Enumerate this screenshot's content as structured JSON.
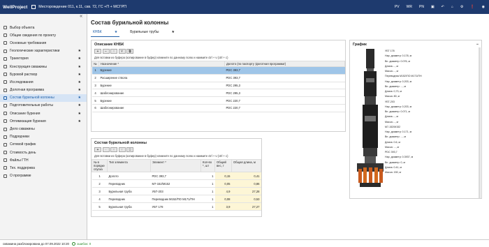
{
  "topbar": {
    "brand": "WellProject",
    "field": "Месторождение 011, к.11, скв. 72, ГС +П + МСГРП",
    "actions": [
      "PV",
      "WR",
      "PN"
    ]
  },
  "sidebar": {
    "collapse": "«",
    "items": [
      {
        "label": "Выбор объекта",
        "star": ""
      },
      {
        "label": "Общие сведения по проекту",
        "star": ""
      },
      {
        "label": "Основные требования",
        "star": ""
      },
      {
        "label": "Геологические характеристики",
        "star": "★"
      },
      {
        "label": "Траектория",
        "star": "★"
      },
      {
        "label": "Конструкция скважины",
        "star": "★"
      },
      {
        "label": "Буровой раствор",
        "star": "★"
      },
      {
        "label": "Исследования",
        "star": "★"
      },
      {
        "label": "Долотная программа",
        "star": "★"
      },
      {
        "label": "Состав бурильной колонны",
        "star": "★",
        "active": true
      },
      {
        "label": "Подготовительные работы",
        "star": "★"
      },
      {
        "label": "Описание бурения",
        "star": "★"
      },
      {
        "label": "Оптимизация бурения",
        "star": "★"
      },
      {
        "label": "Дело скважины",
        "star": ""
      },
      {
        "label": "Подрядчики",
        "star": ""
      },
      {
        "label": "Сетевой график",
        "star": ""
      },
      {
        "label": "Стоимость день",
        "star": ""
      },
      {
        "label": "Файлы ГТН",
        "star": ""
      },
      {
        "label": "Тех. поддержка",
        "star": ""
      },
      {
        "label": "О программе",
        "star": ""
      }
    ]
  },
  "main": {
    "title": "Состав бурильной колонны",
    "tabs": [
      {
        "label": "КНБК",
        "star": "★"
      },
      {
        "label": "Бурильные трубы",
        "star": "★"
      }
    ]
  },
  "knbk": {
    "title": "Описание КНБК",
    "hint": "Для вставки из буфера (копирование в буфер) кликните по данному полю и нажмите ctrl + v (ctrl + c)",
    "columns": [
      "№",
      "Назначение *",
      "Долото (по паспорту 'Долотная программа')"
    ],
    "rows": [
      [
        "1",
        "Бурение",
        "PDC 393,7"
      ],
      [
        "2",
        "Расширение ствола",
        "PDC 393,7"
      ],
      [
        "3",
        "Бурение",
        "PDC 295,3"
      ],
      [
        "4",
        "Шаблонирование",
        "PDC 295,3"
      ],
      [
        "5",
        "Бурение",
        "PDC 220,7"
      ],
      [
        "6",
        "Шаблонирование",
        "PDC 220,7"
      ]
    ]
  },
  "string": {
    "title": "Состав бурильной колонны",
    "hint": "Для вставки из буфера (копирование в буфер) кликните по данному полю и нажмите ctrl + v (ctrl + c)",
    "columns": [
      "№ в порядке спуска",
      "Тип элемента",
      "Элемент *",
      "Кол-во *, шт",
      "Общий вес, т",
      "Общая длина, м"
    ],
    "rows": [
      [
        "1",
        "Долото",
        "PDC 393,7",
        "1",
        "0,15",
        "0,41"
      ],
      [
        "2",
        "Переводник",
        "М7-152/М152",
        "1",
        "0,05",
        "0,86"
      ],
      [
        "3",
        "Бурильная труба",
        "УБТ-203",
        "1",
        "4,9",
        "27,28"
      ],
      [
        "4",
        "Переводник",
        "Переводник М152/ПО М171/ПН",
        "1",
        "0,08",
        "0,53"
      ],
      [
        "5",
        "Бурильная труба",
        "УБТ 178",
        "1",
        "3,9",
        "27,27"
      ]
    ]
  },
  "graph": {
    "title": "График",
    "collapse": "−",
    "notes": [
      "УБТ 178",
      "Нар. диаметр: 0.178, м",
      "Вн. диаметр: 0.076, м",
      "Длина:..., м",
      "Масса:..., кг",
      "Переводник М152/ПО М171/ПН",
      "Нар. диаметр: 0.203, м",
      "Вн. диаметр: ..., м",
      "Длина: 0,73, м",
      "Масса: 80, кг",
      "УБТ-203",
      "Нар. диаметр: 0.203, м",
      "Вн. диаметр: 0.071, м",
      "Длина:..., м",
      "Масса:..., кг",
      "М7-152/М152",
      "Нар. диаметр: 0.171, м",
      "Вн. диаметр: ..., м",
      "Длина: 0.6, м",
      "Масса: ..., кг",
      "PDC 393,7",
      "Нар. диаметр: 0.3937, м",
      "Вн. диаметр: 0, м",
      "Длина: 0.41, м",
      "Масса: 150, кг"
    ]
  },
  "status": {
    "text": "скважина разблокирована до 07.09.2022 10:20",
    "errors": "ошибок: 0"
  }
}
